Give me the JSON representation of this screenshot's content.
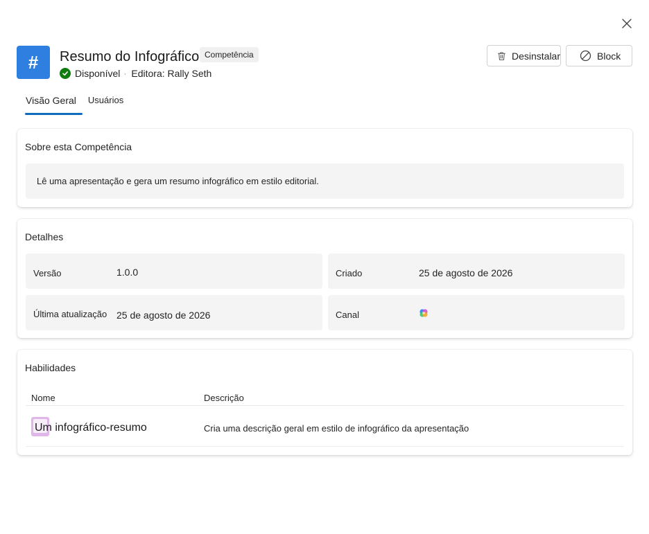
{
  "header": {
    "close_icon": "close-icon",
    "app_icon_glyph": "#",
    "app_icon_color": "#2f7fe0",
    "title": "Resumo do Infográfico",
    "type_badge": "Competência",
    "status": "Disponível",
    "status_color": "#107c10",
    "publisher": "Editora: Rally Seth"
  },
  "actions": {
    "uninstall_label": "Desinstalar",
    "uninstall_icon": "trash-icon",
    "block_label": "Block",
    "block_icon": "block-icon"
  },
  "tabs": [
    {
      "label": "Visão Geral",
      "active": true
    },
    {
      "label": "Usuários",
      "active": false
    }
  ],
  "accent_color": "#0f6cbd",
  "about": {
    "title": "Sobre esta Competência",
    "description": "Lê uma apresentação e gera um resumo infográfico em estilo editorial."
  },
  "details": {
    "title": "Detalhes",
    "fields": [
      {
        "label": "Versão",
        "value": "1.0.0"
      },
      {
        "label": "Criado",
        "value": "25 de agosto de 2026"
      },
      {
        "label": "Última atualização",
        "value": "25 de agosto de 2026"
      },
      {
        "label": "Canal",
        "value": "",
        "icon": "copilot-icon"
      }
    ]
  },
  "skills": {
    "title": "Habilidades",
    "columns": [
      "Nome",
      "Descrição"
    ],
    "rows": [
      {
        "name": "Um infográfico-resumo",
        "description": "Cria uma descrição geral em estilo de infográfico da apresentação",
        "icon": "skill-icon"
      }
    ]
  }
}
